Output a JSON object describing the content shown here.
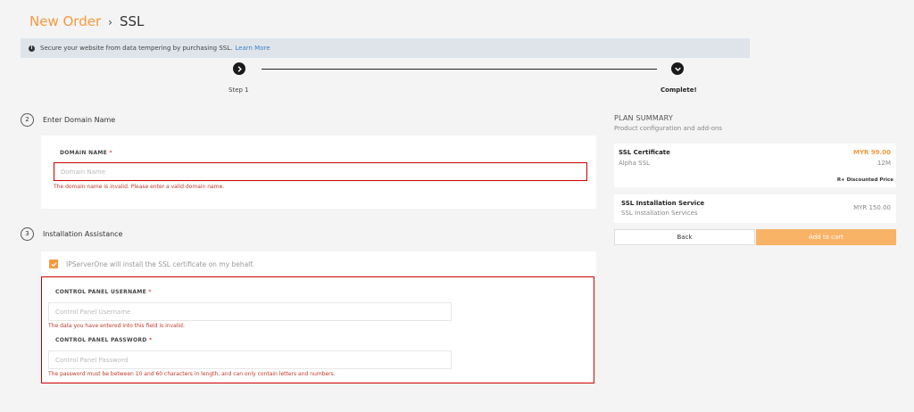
{
  "header": {
    "breadcrumb_parent": "New Order",
    "separator": "›",
    "breadcrumb_current": "SSL"
  },
  "info_bar": {
    "icon": "info-icon",
    "message": "Secure your website from data tempering by purchasing SSL.",
    "link_text": "Learn More"
  },
  "stepper": {
    "steps": [
      {
        "label": "Step 1",
        "icon": "chevron-right-icon"
      },
      {
        "label": "Complete!",
        "icon": "chevron-down-icon"
      }
    ]
  },
  "domain_section": {
    "number": "2",
    "title": "Enter Domain Name",
    "field_label": "DOMAIN NAME",
    "required_mark": "*",
    "placeholder": "Domain Name",
    "value": "",
    "error": "The domain name is invalid. Please enter a valid domain name."
  },
  "installation_section": {
    "number": "3",
    "title": "Installation Assistance",
    "checkbox_label": "IPServerOne will install the SSL certificate on my behalf.",
    "checkbox_checked": true,
    "username": {
      "label": "CONTROL PANEL USERNAME",
      "required_mark": "*",
      "placeholder": "Control Panel Username",
      "error": "The data you have entered into this field is invalid."
    },
    "password": {
      "label": "CONTROL PANEL PASSWORD",
      "required_mark": "*",
      "placeholder": "Control Panel Password",
      "error": "The password must be between 10 and 60 characters in length, and can only contain letters and numbers."
    }
  },
  "plan_summary": {
    "title": "PLAN SUMMARY",
    "subtitle": "Product configuration and add-ons",
    "items": [
      {
        "name": "SSL Certificate",
        "sub": "Alpha SSL",
        "price": "MYR 99.00",
        "period": "12M",
        "note": "R+ Discounted Price"
      },
      {
        "name": "SSL Installation Service",
        "sub": "SSL Installation Services",
        "price": "MYR 150.00"
      }
    ],
    "back_label": "Back",
    "add_label": "Add to cart"
  },
  "colors": {
    "accent": "#f6993f",
    "error": "#cc0000",
    "info_bg": "#dfe4ea"
  }
}
